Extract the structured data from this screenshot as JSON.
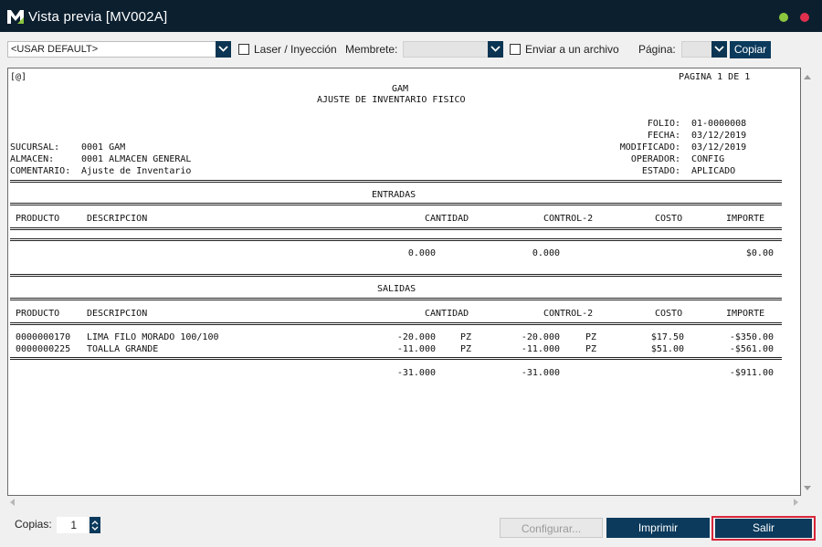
{
  "window": {
    "title": "Vista previa [MV002A]",
    "logo_letter": "M",
    "colors": {
      "titlebar": "#0b1f2f",
      "accent": "#0b3a5c",
      "minimize": "#8cc63f",
      "close": "#e0304e",
      "highlight": "#d8263a"
    },
    "icons": {
      "minimize": "minimize-icon",
      "close": "close-icon"
    }
  },
  "toolbar": {
    "printer_combo": "<USAR DEFAULT>",
    "laser_label": "Laser / Inyección",
    "membrete_label": "Membrete:",
    "membrete_value": "",
    "enviar_label": "Enviar a un archivo",
    "pagina_label": "Página:",
    "pagina_value": "",
    "copiar_label": "Copiar"
  },
  "report": {
    "marker": "[@]",
    "page": "PAGINA 1 DE 1",
    "company": "GAM",
    "title": "AJUSTE DE INVENTARIO FISICO",
    "folio_label": "FOLIO:",
    "folio": "01-0000008",
    "fecha_label": "FECHA:",
    "fecha": "03/12/2019",
    "modificado_label": "MODIFICADO:",
    "modificado": "03/12/2019",
    "operador_label": "OPERADOR:",
    "operador": "CONFIG",
    "estado_label": "ESTADO:",
    "estado": "APLICADO",
    "sucursal_label": "SUCURSAL:",
    "sucursal": "0001 GAM",
    "almacen_label": "ALMACEN:",
    "almacen": "0001 ALMACEN GENERAL",
    "comentario_label": "COMENTARIO:",
    "comentario": "Ajuste de Inventario",
    "columns": {
      "producto": "PRODUCTO",
      "descripcion": "DESCRIPCION",
      "cantidad": "CANTIDAD",
      "control2": "CONTROL-2",
      "costo": "COSTO",
      "importe": "IMPORTE"
    },
    "entradas": {
      "heading": "ENTRADAS",
      "rows": [],
      "total_cantidad": "0.000",
      "total_control2": "0.000",
      "total_importe": "$0.00"
    },
    "salidas": {
      "heading": "SALIDAS",
      "rows": [
        {
          "producto": "0000000170",
          "descripcion": "LIMA FILO MORADO 100/100",
          "cantidad": "-20.000",
          "unidad": "PZ",
          "control2": "-20.000",
          "unidad2": "PZ",
          "costo": "$17.50",
          "importe": "-$350.00"
        },
        {
          "producto": "0000000225",
          "descripcion": "TOALLA GRANDE",
          "cantidad": "-11.000",
          "unidad": "PZ",
          "control2": "-11.000",
          "unidad2": "PZ",
          "costo": "$51.00",
          "importe": "-$561.00"
        }
      ],
      "total_cantidad": "-31.000",
      "total_control2": "-31.000",
      "total_importe": "-$911.00"
    }
  },
  "footer": {
    "copias_label": "Copias:",
    "copias_value": "1",
    "configurar_label": "Configurar...",
    "imprimir_label": "Imprimir",
    "salir_label": "Salir"
  }
}
